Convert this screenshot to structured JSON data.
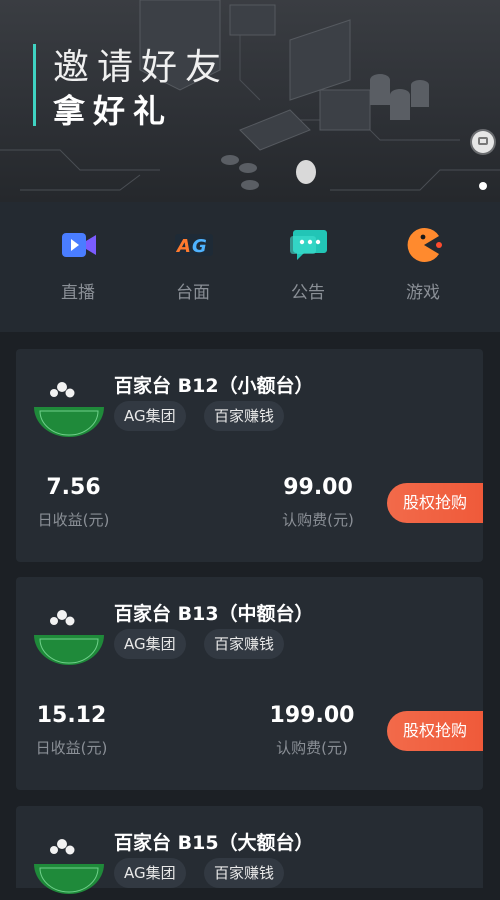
{
  "banner": {
    "line1": "邀请好友",
    "line2": "拿好礼",
    "accent_color": "#3fd3c2"
  },
  "nav": {
    "items": [
      {
        "label": "直播",
        "icon": "video-camera-icon"
      },
      {
        "label": "台面",
        "icon": "ag-logo-icon"
      },
      {
        "label": "公告",
        "icon": "chat-bubble-icon"
      },
      {
        "label": "游戏",
        "icon": "pacman-icon"
      }
    ]
  },
  "cards": [
    {
      "title": "百家台 B12（小额台）",
      "tags": [
        "AG集团",
        "百家赚钱"
      ],
      "daily_income": "7.56",
      "daily_income_label": "日收益(元)",
      "fee": "99.00",
      "fee_label": "认购费(元)",
      "button_label": "股权抢购"
    },
    {
      "title": "百家台 B13（中额台）",
      "tags": [
        "AG集团",
        "百家赚钱"
      ],
      "daily_income": "15.12",
      "daily_income_label": "日收益(元)",
      "fee": "199.00",
      "fee_label": "认购费(元)",
      "button_label": "股权抢购"
    },
    {
      "title": "百家台 B15（大额台）",
      "tags": [
        "AG集团",
        "百家赚钱"
      ]
    }
  ],
  "colors": {
    "background": "#1c2025",
    "card": "#262c33",
    "button": "#f0623f"
  }
}
